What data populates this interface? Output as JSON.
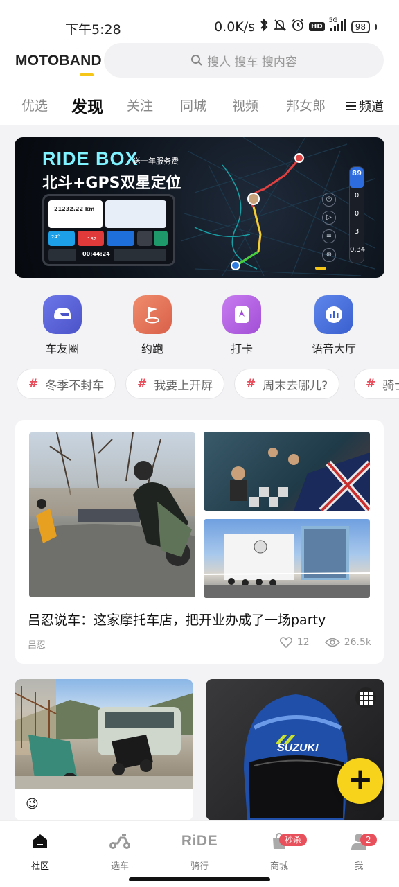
{
  "status": {
    "time": "下午5:28",
    "speed": "0.0K/s",
    "hd": "HD",
    "signal": "5G",
    "battery": "98"
  },
  "header": {
    "brand": "MOTOBAND",
    "search_placeholder": "搜人 搜车 搜内容",
    "tabs": [
      "优选",
      "发现",
      "关注",
      "同城",
      "视频",
      "邦女郎"
    ],
    "active_tab": "发现",
    "channel_label": "频道"
  },
  "banner": {
    "title": "RIDE BOX",
    "subtitle": "送一年服务费",
    "headline": "北斗+GPS双星定位",
    "device_distance": "21232.22 km",
    "device_time": "00:44:24",
    "device_speed": "132",
    "device_temp": "24°",
    "right_panel": [
      "89",
      "0",
      "0",
      "3",
      "0.34"
    ]
  },
  "actions": [
    {
      "label": "车友圈",
      "icon": "helmet-icon",
      "color": "#5b63d8"
    },
    {
      "label": "约跑",
      "icon": "flag-icon",
      "color": "#e8775a"
    },
    {
      "label": "打卡",
      "icon": "bookmark-icon",
      "color": "#b85ee0"
    },
    {
      "label": "语音大厅",
      "icon": "audio-icon",
      "color": "#4a6fd8"
    }
  ],
  "hashtags": [
    "冬季不封车",
    "我要上开屏",
    "周末去哪儿?",
    "骑士"
  ],
  "feature_card": {
    "title": "吕忍说车：这家摩托车店，把开业办成了一场party",
    "author": "吕忍",
    "likes": "12",
    "views": "26.5k"
  },
  "grid_cards": [
    {
      "emoji": "😉"
    },
    {
      "has_gallery_icon": true
    }
  ],
  "fab": {
    "label": "+"
  },
  "bottom_nav": [
    {
      "label": "社区",
      "icon": "home-icon",
      "active": true
    },
    {
      "label": "选车",
      "icon": "scooter-icon",
      "active": false
    },
    {
      "label": "骑行",
      "icon": "ride-logo",
      "logo_text": "RiDE",
      "active": false
    },
    {
      "label": "商城",
      "icon": "bag-icon",
      "badge": "秒杀",
      "active": false
    },
    {
      "label": "我",
      "icon": "user-icon",
      "badge": "2",
      "active": false
    }
  ],
  "colors": {
    "accent_yellow": "#f5c518",
    "hashtag_red": "#e84c5a",
    "badge_red": "#e8505b",
    "banner_cyan": "#7ff3ff"
  }
}
